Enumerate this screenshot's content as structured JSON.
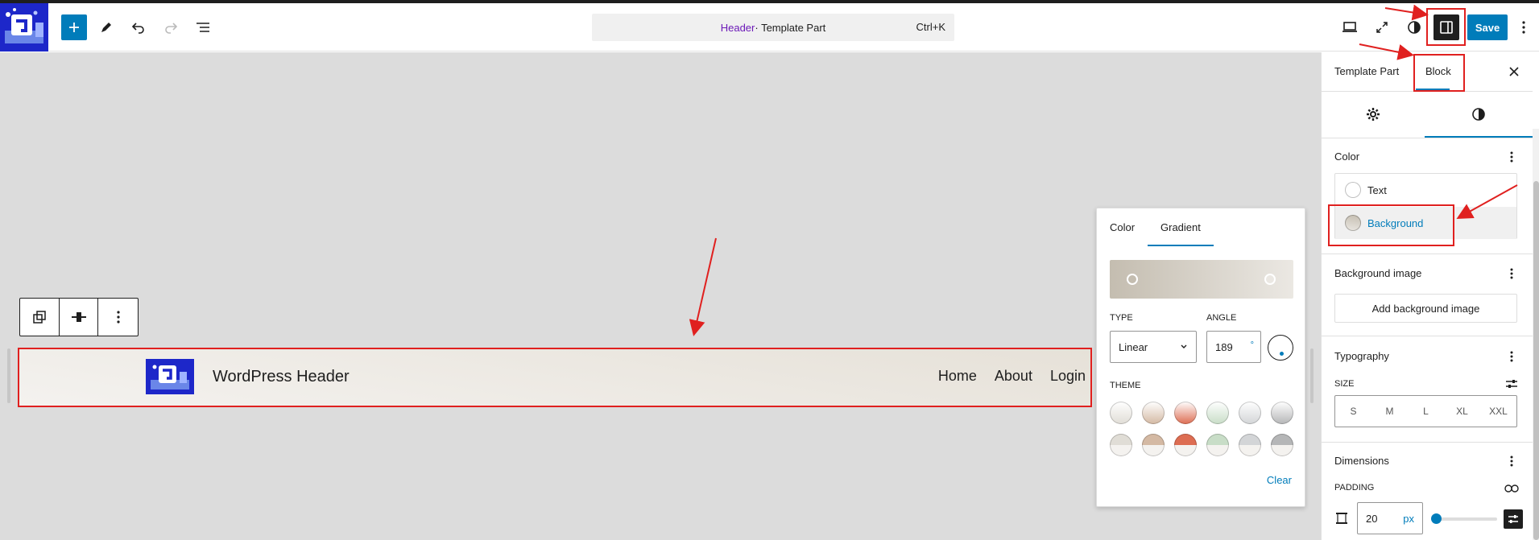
{
  "topbar": {
    "command_highlight": "Header",
    "command_rest": " · Template Part",
    "command_shortcut": "Ctrl+K",
    "save_label": "Save"
  },
  "canvas": {
    "header_title": "WordPress Header",
    "nav": [
      "Home",
      "About",
      "Login"
    ]
  },
  "popover": {
    "tabs": [
      "Color",
      "Gradient"
    ],
    "active_tab": "Gradient",
    "type_label": "TYPE",
    "type_value": "Linear",
    "angle_label": "ANGLE",
    "angle_value": "189",
    "angle_unit": "°",
    "theme_label": "THEME",
    "clear_label": "Clear",
    "swatch_colors": [
      "#e0ddd6",
      "#d4b9a3",
      "#dd6d52",
      "#c8ddc7",
      "#d3d5d7",
      "#b5b6b7"
    ],
    "gradient_colors": [
      "#c4bdb0",
      "#ebe8e3"
    ]
  },
  "sidebar": {
    "tabs": [
      "Template Part",
      "Block"
    ],
    "active_tab": "Block",
    "color_panel_title": "Color",
    "color_items": [
      "Text",
      "Background"
    ],
    "bg_image_title": "Background image",
    "add_bg_image_label": "Add background image",
    "typography_title": "Typography",
    "size_label": "SIZE",
    "sizes": [
      "S",
      "M",
      "L",
      "XL",
      "XXL"
    ],
    "dimensions_title": "Dimensions",
    "padding_label": "PADDING",
    "padding_value": "20",
    "padding_unit": "px"
  },
  "colors": {
    "accent": "#007cba",
    "annotation": "#e0201f",
    "logo_bg": "#1d27c9"
  }
}
